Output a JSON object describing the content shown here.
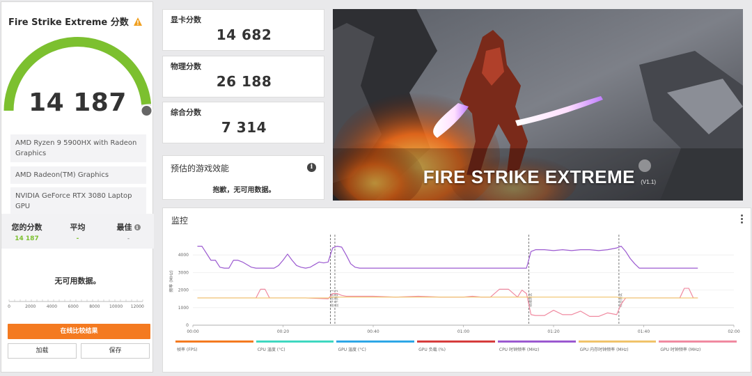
{
  "left": {
    "title": "Fire Strike Extreme 分数",
    "score": "14 187",
    "score_value": 14187,
    "gauge_fraction": 0.97,
    "hardware": [
      "AMD Ryzen 9 5900HX with Radeon Graphics",
      "AMD Radeon(TM) Graphics",
      "NVIDIA GeForce RTX 3080 Laptop GPU"
    ],
    "compare": {
      "your_label": "您的分数",
      "your_value": "14 187",
      "avg_label": "平均",
      "avg_value": "-",
      "best_label": "最佳",
      "best_value": "-"
    },
    "no_data": "无可用数据。",
    "hist_ticks": [
      "0",
      "2000",
      "4000",
      "6000",
      "8000",
      "10000",
      "12000"
    ],
    "online_button": "在线比较结果",
    "load_button": "加载",
    "save_button": "保存"
  },
  "cards": {
    "graphics_label": "显卡分数",
    "graphics_value": "14 682",
    "physics_label": "物理分数",
    "physics_value": "26 188",
    "combined_label": "综合分数",
    "combined_value": "7 314"
  },
  "perf": {
    "label": "预估的游戏效能",
    "message": "抱歉，无可用数据。"
  },
  "hero": {
    "title": "FIRE STRIKE EXTREME",
    "version": "(V1.1)"
  },
  "monitor": {
    "title": "监控"
  },
  "colors": {
    "gauge_green": "#7cc02f",
    "orange": "#f47a20",
    "clock_purple": "#9b59d0",
    "gpu_clock": "#f08aa0",
    "mem_clock": "#f0c36a"
  },
  "chart_data": {
    "type": "line",
    "ylabel": "频率 (MHz)",
    "ylim": [
      0,
      5000
    ],
    "yticks": [
      "0",
      "1000",
      "2000",
      "3000",
      "4000"
    ],
    "xticks": [
      "00:00",
      "00:20",
      "00:40",
      "01:00",
      "01:20",
      "01:40",
      "02:00"
    ],
    "xlim_seconds": [
      0,
      120
    ],
    "markers": [
      {
        "t": 30.5,
        "label": "显卡测试 1"
      },
      {
        "t": 31.5,
        "label": "显卡测试 2"
      },
      {
        "t": 74.5,
        "label": "物理测试"
      },
      {
        "t": 94.5,
        "label": "综合测试"
      }
    ],
    "series": [
      {
        "name": "CPU 时钟频率 (MHz)",
        "color": "#9b59d0",
        "x": [
          1,
          2,
          4,
          5,
          6,
          7,
          8,
          9,
          10,
          11,
          13,
          14,
          15,
          16,
          17,
          18,
          19,
          20,
          21,
          22,
          23,
          24,
          25,
          26,
          27,
          28,
          29,
          30,
          31,
          32,
          33,
          34,
          35,
          36,
          37,
          38,
          40,
          45,
          50,
          55,
          60,
          65,
          70,
          74,
          75,
          76,
          78,
          80,
          82,
          84,
          86,
          88,
          90,
          92,
          94,
          95,
          96,
          97,
          98,
          99,
          100,
          105,
          110,
          112
        ],
        "y": [
          4500,
          4500,
          3700,
          3700,
          3300,
          3250,
          3250,
          3700,
          3700,
          3600,
          3300,
          3250,
          3250,
          3250,
          3250,
          3250,
          3400,
          3700,
          4050,
          3700,
          3400,
          3300,
          3250,
          3300,
          3450,
          3600,
          3550,
          3600,
          4400,
          4500,
          4450,
          4000,
          3500,
          3300,
          3250,
          3250,
          3250,
          3250,
          3250,
          3250,
          3250,
          3250,
          3250,
          3250,
          4200,
          4300,
          4300,
          4250,
          4300,
          4250,
          4300,
          4300,
          4250,
          4300,
          4400,
          4500,
          4200,
          3800,
          3500,
          3250,
          3250,
          3250,
          3250,
          3250
        ]
      },
      {
        "name": "GPU 时钟频率 (MHz)",
        "color": "#f08aa0",
        "x": [
          1,
          5,
          10,
          14,
          15,
          16,
          17,
          18,
          20,
          25,
          30,
          31,
          32,
          33,
          34,
          36,
          40,
          45,
          50,
          55,
          60,
          62,
          64,
          66,
          68,
          70,
          72,
          73,
          74,
          75,
          76,
          78,
          80,
          82,
          84,
          86,
          88,
          90,
          92,
          94,
          95,
          96,
          98,
          100,
          105,
          108,
          109,
          110,
          111,
          112
        ],
        "y": [
          1550,
          1550,
          1550,
          1550,
          2050,
          2050,
          1550,
          1550,
          1550,
          1550,
          1500,
          1800,
          1800,
          1700,
          1650,
          1650,
          1650,
          1600,
          1650,
          1600,
          1600,
          1650,
          1600,
          1600,
          2050,
          2050,
          1600,
          2000,
          1800,
          600,
          550,
          550,
          850,
          600,
          600,
          800,
          500,
          500,
          700,
          600,
          1200,
          1550,
          1550,
          1550,
          1550,
          1550,
          2100,
          2100,
          1550,
          1550
        ]
      },
      {
        "name": "GPU 内存时钟频率 (MHz)",
        "color": "#f0c36a",
        "x": [
          1,
          30,
          31,
          74,
          75,
          94,
          95,
          112
        ],
        "y": [
          1550,
          1550,
          1600,
          1600,
          1600,
          1600,
          1550,
          1550
        ]
      }
    ],
    "legend": [
      {
        "label": "帧率 (FPS)",
        "color": "#f47a20"
      },
      {
        "label": "CPU 温度 (°C)",
        "color": "#3fd8c0"
      },
      {
        "label": "GPU 温度 (°C)",
        "color": "#2ea7e6"
      },
      {
        "label": "GPU 负载 (%)",
        "color": "#d63c3c"
      },
      {
        "label": "CPU 时钟频率 (MHz)",
        "color": "#9b59d0"
      },
      {
        "label": "GPU 内存时钟频率 (MHz)",
        "color": "#f0c36a"
      },
      {
        "label": "GPU 时钟频率 (MHz)",
        "color": "#f08aa0"
      }
    ]
  }
}
